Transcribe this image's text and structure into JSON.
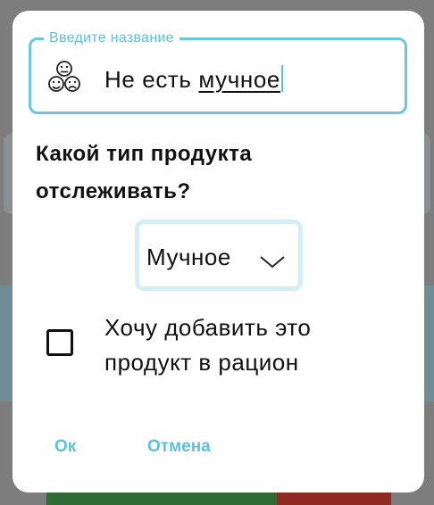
{
  "dialog": {
    "name_field": {
      "label": "Введите название",
      "value_plain": "Не есть ",
      "value_underlined": "мучное",
      "icon": "emoji-faces-icon"
    },
    "question": "Какой тип продукта отслеживать?",
    "type_select": {
      "selected": "Мучное",
      "icon": "chevron-down-icon"
    },
    "checkbox": {
      "label": "Хочу добавить это продукт в рацион",
      "checked": false
    },
    "buttons": {
      "ok": "Ок",
      "cancel": "Отмена"
    }
  },
  "colors": {
    "accent": "#5fc0dc",
    "field_border": "#6cc6dc",
    "select_border": "#d4eef5",
    "scrim": "#7d7d7d",
    "bottom_green": "#2f6b35",
    "bottom_red": "#8e2a22"
  }
}
